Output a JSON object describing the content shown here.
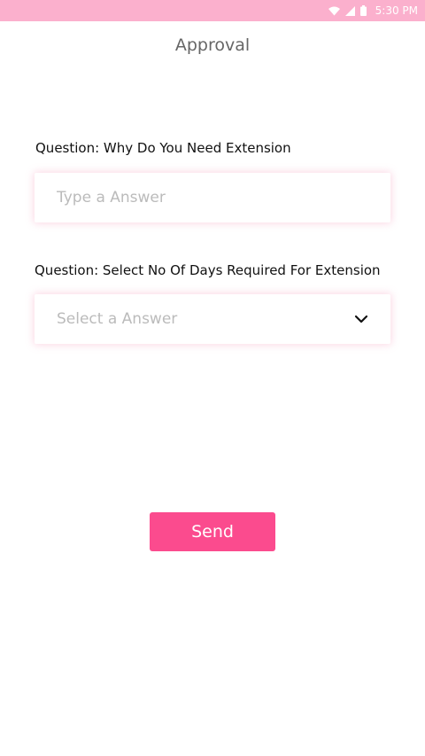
{
  "status_bar": {
    "time": "5:30 PM",
    "icons": [
      "wifi-icon",
      "signal-icon",
      "battery-icon"
    ],
    "color": "#fbb0cd"
  },
  "header": {
    "title": "Approval"
  },
  "form": {
    "question_1": {
      "label": "Question: Why Do You Need Extension",
      "placeholder": "Type a Answer",
      "value": ""
    },
    "question_2": {
      "label": "Question: Select No Of Days Required For Extension",
      "placeholder": "Select a Answer",
      "icon": "chevron-down-icon"
    },
    "send_label": "Send",
    "send_color": "#fb4b8e"
  }
}
